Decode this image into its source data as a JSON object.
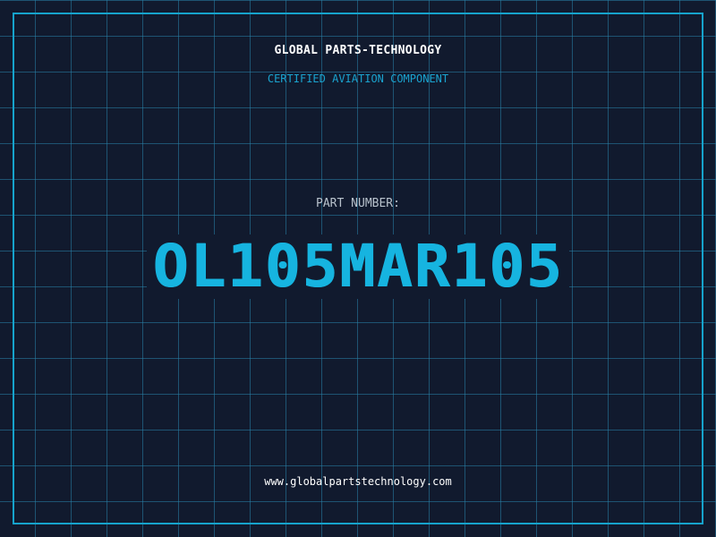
{
  "label": {
    "company": "GLOBAL PARTS-TECHNOLOGY",
    "subtitle": "CERTIFIED AVIATION COMPONENT",
    "part_number_label": "PART NUMBER:",
    "part_number": "OL105MAR105",
    "website": "www.globalpartstechnology.com"
  },
  "colors": {
    "background": "#111a2e",
    "grid": "#2882aa",
    "accent": "#16a3cc",
    "text": "#ffffff"
  }
}
